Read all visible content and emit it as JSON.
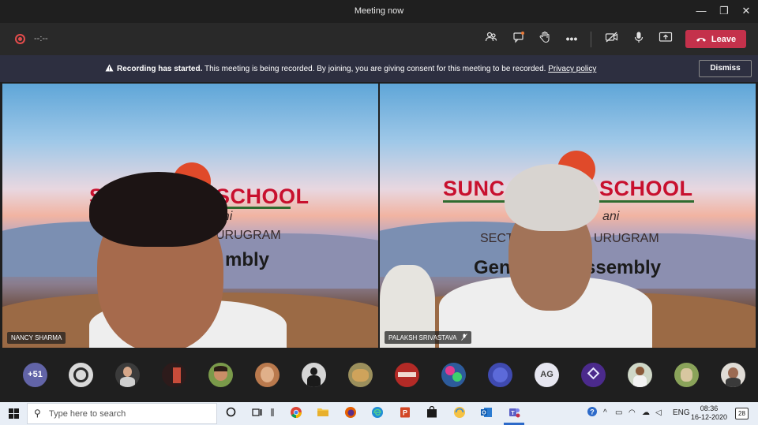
{
  "window": {
    "title": "Meeting now",
    "minimize": "—",
    "maximize": "❐",
    "close": "✕"
  },
  "toolbar": {
    "timer": "--:--",
    "leave_label": "Leave",
    "icons": [
      "participants-icon",
      "chat-icon",
      "raise-hand-icon",
      "more-icon",
      "camera-off-icon",
      "mic-icon",
      "share-tray-icon"
    ]
  },
  "banner": {
    "bold": "Recording has started.",
    "text": " This meeting is being recorded. By joining, you are giving consent for this meeting to be recorded. ",
    "link": "Privacy policy",
    "dismiss_label": "Dismiss"
  },
  "tiles": [
    {
      "name": "NANCY SHARMA",
      "school_left": "SU",
      "school_right": "SCHOOL",
      "sub1": "ani",
      "sub2": "URUGRAM",
      "assembly": "mbly"
    },
    {
      "name": "PALAKSH SRIVASTAVA",
      "school_left": "SUNC",
      "school_right": "SCHOOL",
      "sub1": "ani",
      "sub2a": "SECT",
      "sub2b": "URUGRAM",
      "assembly_a": "Gen",
      "assembly_b": "ssembly"
    }
  ],
  "participants": {
    "overflow": "+51",
    "initials": "AG"
  },
  "taskbar": {
    "search_placeholder": "Type here to search",
    "lang": "ENG",
    "time": "08:36",
    "date": "16-12-2020",
    "notifications": "28"
  },
  "colors": {
    "leave": "#c4314b",
    "banner": "#2d2f40",
    "overflow_avatar": "#6264a7"
  }
}
